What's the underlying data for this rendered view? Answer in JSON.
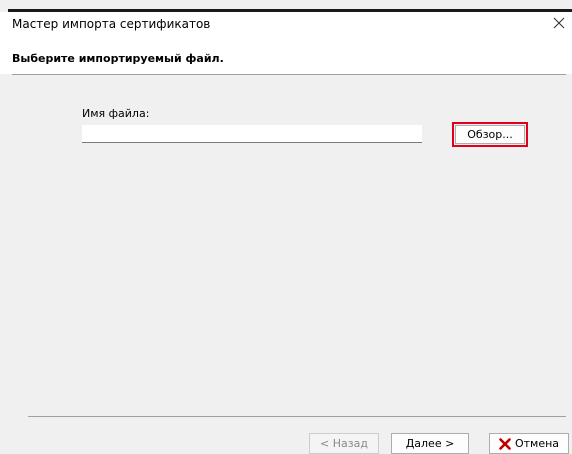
{
  "window": {
    "title": "Мастер импорта сертификатов"
  },
  "header": {
    "title": "Выберите импортируемый файл."
  },
  "form": {
    "filename_label": "Имя файла:",
    "filename_value": "",
    "browse_label": "Обзор..."
  },
  "footer": {
    "back_label": "< Назад",
    "next_label": "Далее >",
    "cancel_label": "Отмена"
  },
  "colors": {
    "highlight": "#e0001b",
    "cancel_icon": "#c00000"
  },
  "icons": {
    "close": "close-icon",
    "cancel": "red-x-icon"
  }
}
